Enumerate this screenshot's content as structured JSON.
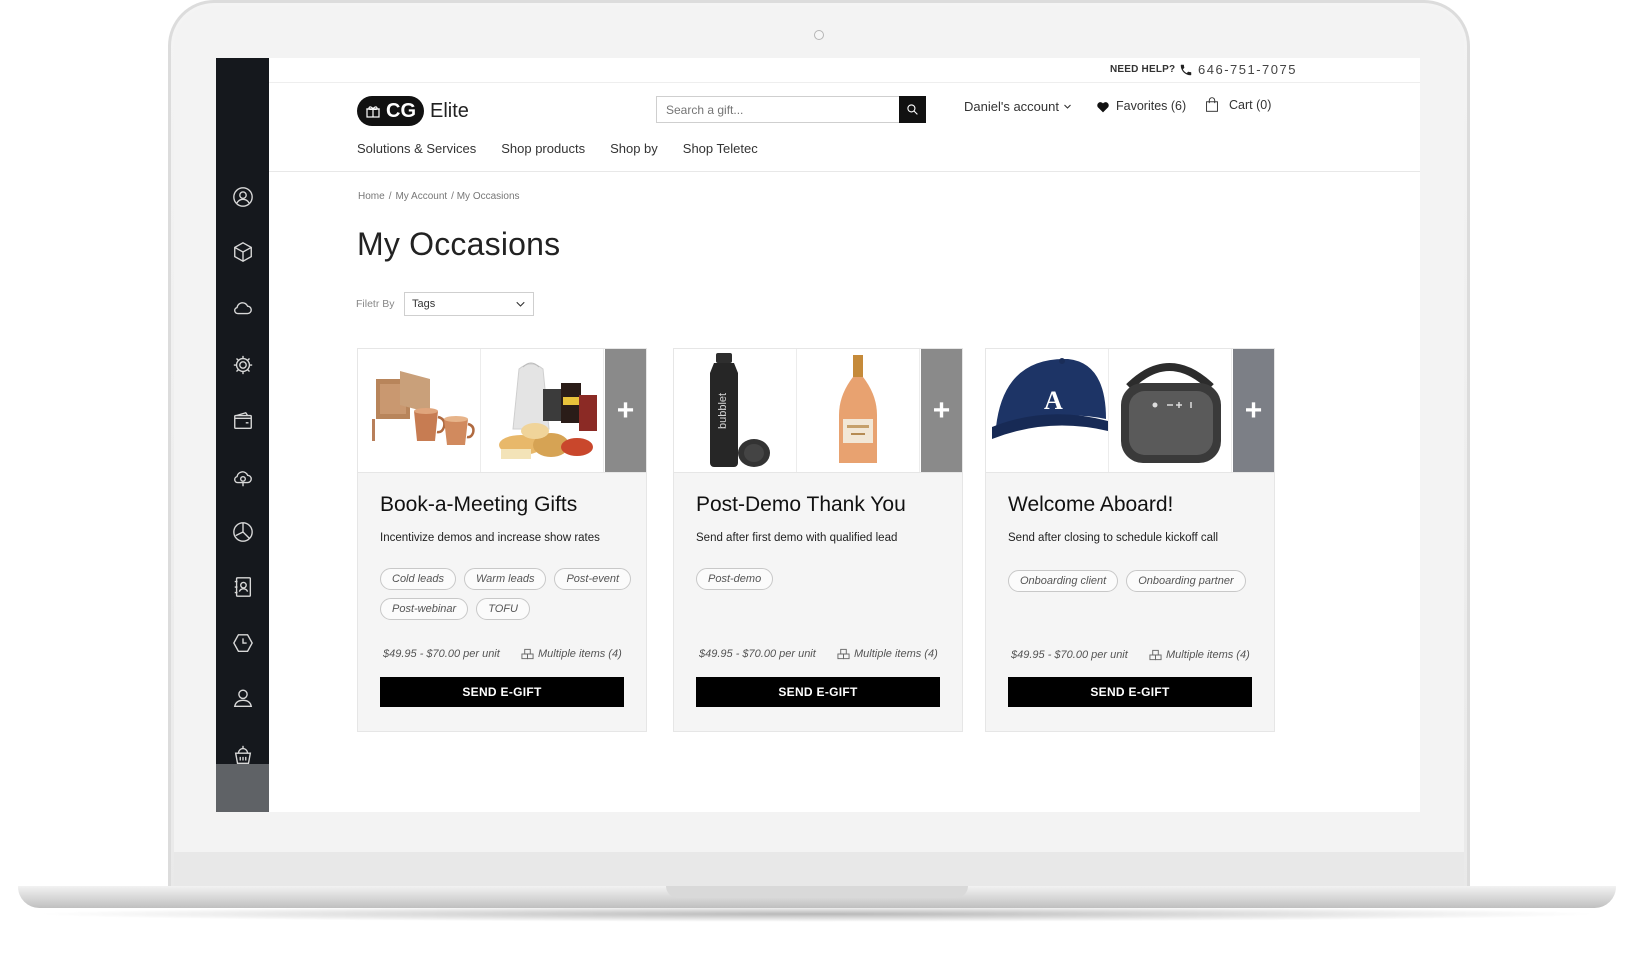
{
  "topbar": {
    "need_help": "NEED HELP?",
    "phone": "646-751-7075"
  },
  "logo": {
    "mark": "CG",
    "name": "Elite"
  },
  "search": {
    "placeholder": "Search a gift..."
  },
  "account": {
    "label": "Daniel's account",
    "favorites": "Favorites (6)",
    "cart": "Cart (0)"
  },
  "nav": [
    "Solutions & Services",
    "Shop products",
    "Shop by",
    "Shop Teletec"
  ],
  "breadcrumb": [
    "Home",
    "/",
    "My Account",
    "/ My Occasions"
  ],
  "page_title": "My Occasions",
  "filter": {
    "label": "Filetr By",
    "selected": "Tags"
  },
  "sidebar_icons": [
    "user-circle-icon",
    "box-icon",
    "cloud-icon",
    "gear-icon",
    "wallet-icon",
    "cloud-money-icon",
    "pie-chart-icon",
    "contacts-book-icon",
    "clock-hexagon-icon",
    "person-icon",
    "gift-basket-icon"
  ],
  "cards": [
    {
      "title": "Book-a-Meeting Gifts",
      "description": "Incentivize demos and increase show rates",
      "tags": [
        "Cold leads",
        "Warm leads",
        "Post-event",
        "Post-webinar",
        "TOFU"
      ],
      "price": "$49.95 - $70.00 per unit",
      "items": "Multiple items (4)",
      "button": "SEND E-GIFT",
      "more": "+"
    },
    {
      "title": "Post-Demo Thank You",
      "description": "Send after first demo with qualified lead",
      "tags": [
        "Post-demo"
      ],
      "price": "$49.95 - $70.00 per unit",
      "items": "Multiple items (4)",
      "button": "SEND E-GIFT",
      "more": "+",
      "bottle_text": "bubblet"
    },
    {
      "title": "Welcome Aboard!",
      "description": "Send after closing to schedule kickoff call",
      "tags": [
        "Onboarding client",
        "Onboarding partner"
      ],
      "price": "$49.95 - $70.00 per unit",
      "items": "Multiple items (4)",
      "button": "SEND E-GIFT",
      "more": "+",
      "cap_letter": "A"
    }
  ]
}
